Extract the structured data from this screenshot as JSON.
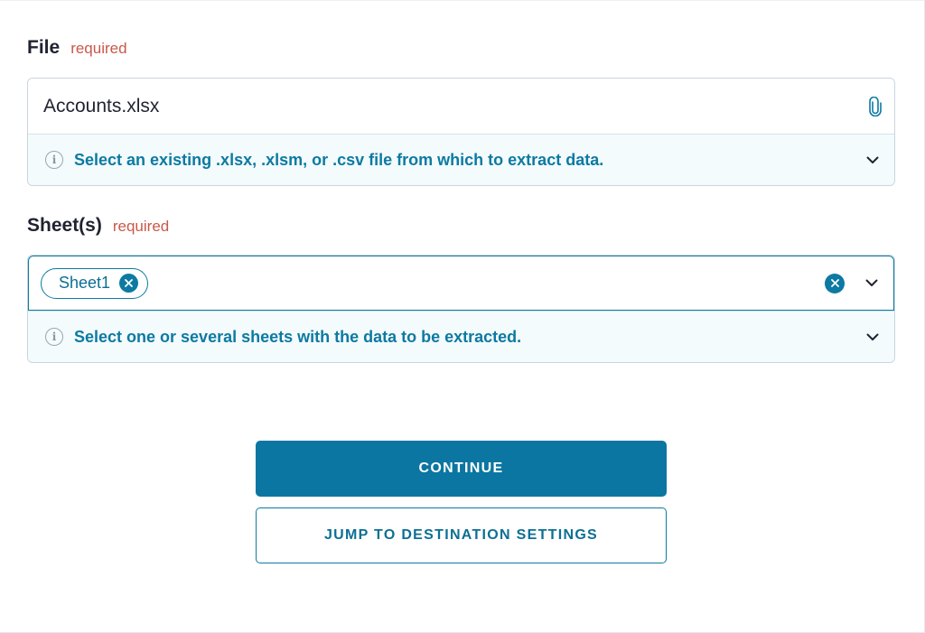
{
  "file_field": {
    "label": "File",
    "required_text": "required",
    "value": "Accounts.xlsx",
    "hint": "Select an existing .xlsx, .xlsm, or .csv file from which to extract data."
  },
  "sheets_field": {
    "label": "Sheet(s)",
    "required_text": "required",
    "chips": [
      "Sheet1"
    ],
    "hint": "Select one or several sheets with the data to be extracted."
  },
  "actions": {
    "continue_label": "CONTINUE",
    "jump_label": "JUMP TO DESTINATION SETTINGS"
  },
  "colors": {
    "accent": "#0a76a1",
    "required": "#c9584a",
    "hint_bg": "#f4fbfd"
  }
}
